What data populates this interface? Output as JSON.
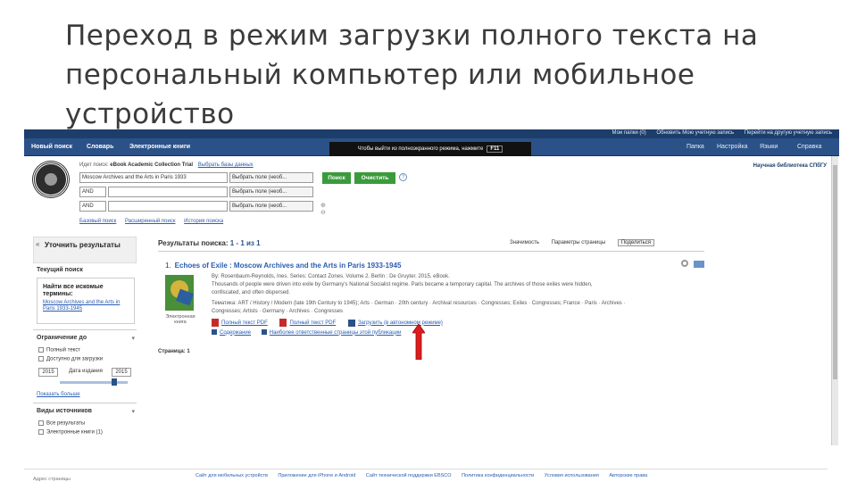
{
  "slide": {
    "title": "Переход в режим загрузки полного текста на персональный компьютер или мобильное устройство"
  },
  "topbar": {
    "links": [
      "Мои папки (0)",
      "Обновить Мою учетную запись",
      "Перейти на другую учетную запись"
    ]
  },
  "navbar": {
    "items": [
      "Новый поиск",
      "Словарь",
      "Электронные книги"
    ],
    "right_items": [
      "Папка",
      "Настройка",
      "Языки",
      "Справка"
    ],
    "notice_text": "Чтобы выйти из полноэкранного режима, нажмите",
    "notice_key": "F11"
  },
  "header": {
    "search_hint": "Идет поиск:",
    "database": "eBook Academic Collection Trial",
    "choose_db": "Выбрать базы данных",
    "rows": [
      {
        "bool": "",
        "value": "Moscow Archives and the Arts in Paris 1933",
        "field": "Выбрать поле (необ..."
      },
      {
        "bool": "AND",
        "value": "",
        "field": "Выбрать поле (необ..."
      },
      {
        "bool": "AND",
        "value": "",
        "field": "Выбрать поле (необ..."
      }
    ],
    "search_button": "Поиск",
    "clear_button": "Очистить",
    "help": "?",
    "adv_links": [
      "Базовый поиск",
      "Расширенный поиск",
      "История поиска"
    ],
    "institution": "Научная библиотека СПбГУ"
  },
  "sidebar": {
    "refine_title": "Уточнить результаты",
    "current_search": "Текущий поиск",
    "not_found": "Найти все искомые термины:",
    "query_link": "Moscow Archives and the Arts in Paris 1933-1945",
    "limit_to": "Ограничение до",
    "limit_options": [
      "Полный текст",
      "Доступно для загрузки"
    ],
    "year_from": "2015",
    "year_label": "Дата издания",
    "year_to": "2015",
    "show_more": "Показать больше",
    "source_types": "Виды источников",
    "source_options": [
      "Все результаты",
      "Электронные книги (1)"
    ]
  },
  "results": {
    "title_prefix": "Результаты поиска:",
    "title_range": "1 - 1 из 1",
    "tools": [
      "Значимость",
      "Параметры страницы",
      "Поделиться"
    ],
    "item_number": "1.",
    "item_title": "Echoes of Exile : Moscow Archives and the Arts in Paris 1933-1945",
    "meta_lines": [
      "By: Rosenbaum-Reynolds, Ines. Series: Contact Zones. Volume 2. Berlin : De Gruyter. 2015. eBook.",
      "Thousands of people were driven into exile by Germany's National Socialist regime. Paris became a temporary capital. The archives of those exiles were hidden,",
      "confiscated, and often dispersed.",
      "Тематика: ART / History / Modern (late 19th Century to 1945); Arts · German · 20th century · Archival resources · Congresses; Exiles · Congresses; France · Paris · Archives ·",
      "Congresses; Artists · Germany · Archives · Congresses"
    ],
    "cover_label": "Электронная книга",
    "pdf_link": "Полный текст PDF",
    "pdf_link2": "Полный текст PDF",
    "download_link": "Загрузить (в автономном режиме)",
    "actions": [
      "Содержание",
      "Наиболее ответственные страницы этой публикации"
    ],
    "pages_label": "Страница: 1"
  },
  "footer": {
    "left": "Адрес страницы",
    "links": [
      "Сайт для мобильных устройств",
      "Приложение для iPhone и Android",
      "Сайт технической поддержки EBSCO",
      "Политика конфиденциальности",
      "Условия использования",
      "Авторские права"
    ]
  },
  "colors": {
    "navbar": "#2b5288",
    "topbar": "#1d3e6b",
    "button_green": "#3a9b3a",
    "link": "#2a5db0",
    "arrow": "#e01b1b"
  }
}
